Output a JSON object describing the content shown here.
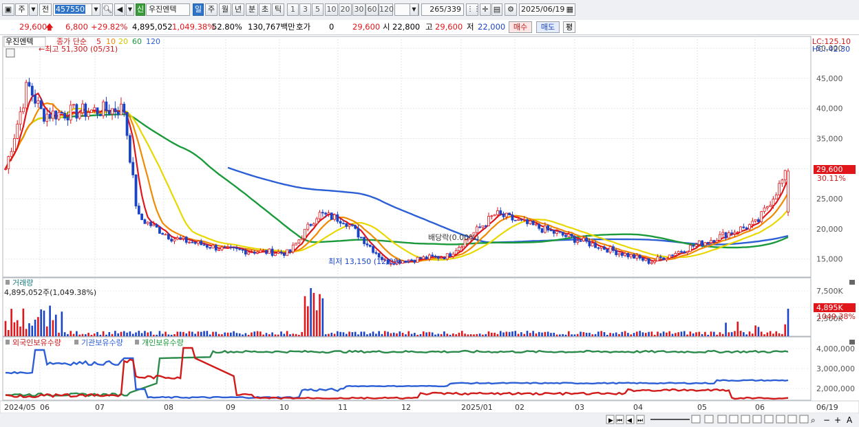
{
  "toolbar": {
    "market": "주",
    "mode": "전",
    "code": "457550",
    "badge": "신",
    "name": "우진엔텍",
    "periods": [
      "일",
      "주",
      "월",
      "년",
      "분",
      "초",
      "틱"
    ],
    "active_period": "일",
    "intervals": [
      "1",
      "3",
      "5",
      "10",
      "20",
      "30",
      "60",
      "120"
    ],
    "count": "265",
    "count_total": "/339",
    "date": "2025/06/19"
  },
  "quote": {
    "price": "29,600",
    "change": "6,800",
    "change_pct": "+29.82%",
    "volume": "4,895,052",
    "volume_pct": "1,049.38%",
    "turnover_pct": "52.80%",
    "amount": "130,767백만",
    "hoga_label": "호가",
    "hoga_value": "0",
    "hoga_price": "29,600",
    "open_label": "시",
    "open": "22,800",
    "high_label": "고",
    "high": "29,600",
    "low_label": "저",
    "low": "22,000",
    "buy_label": "매수",
    "sell_label": "매도",
    "flat_label": "평"
  },
  "price_panel": {
    "name_tag": "우진엔텍",
    "legend_prefix": "종가 단순",
    "ma_labels": [
      "5",
      "10",
      "20",
      "60",
      "120"
    ],
    "ma_colors": [
      "#e0161b",
      "#f08a00",
      "#e8d800",
      "#1a9a3a",
      "#2c5fd6"
    ],
    "lc_label": "LC:125.10",
    "hc_label": "HC:-42.30",
    "high_note": "최고 51,300 (05/31)",
    "low_note": "최저 13,150 (12/09)",
    "dividend_note": "배당락(0.00%)",
    "last_price_tag": "29,600",
    "last_pct_tag": "30.11%",
    "y_ticks": [
      "50,000",
      "45,000",
      "40,000",
      "35,000",
      "30,000",
      "25,000",
      "20,000",
      "15,000"
    ]
  },
  "volume_panel": {
    "title": "거래량",
    "value_label": "4,895,052주(1,049.38%)",
    "y_ticks": [
      "7,500K",
      "5,000K",
      "2,500K"
    ],
    "last_tag": "4,895K",
    "last_pct_tag": "1049.38%"
  },
  "holding_panel": {
    "legends": [
      "외국인보유수량",
      "기관보유수량",
      "개인보유수량"
    ],
    "y_ticks": [
      "4,000,000",
      "3,000,000",
      "2,000,000"
    ]
  },
  "x_axis": {
    "labels": [
      "2024/05",
      "06",
      "07",
      "08",
      "09",
      "10",
      "11",
      "12",
      "2025/01",
      "02",
      "03",
      "04",
      "05",
      "06"
    ],
    "right_label": "06/19"
  },
  "chart_data": {
    "type": "candlestick",
    "title": "우진엔텍",
    "x_range": [
      "2024/05",
      "2025/06/19"
    ],
    "ylim": [
      12000,
      51500
    ],
    "price_path": [
      {
        "m": "2024/05",
        "close": 30000
      },
      {
        "m": "2024/05 end",
        "close": 44000
      },
      {
        "m": "06",
        "close": 39000
      },
      {
        "m": "07 mid",
        "close": 40000
      },
      {
        "m": "07 end",
        "close": 22000
      },
      {
        "m": "08",
        "close": 18500
      },
      {
        "m": "09",
        "close": 16500
      },
      {
        "m": "10",
        "close": 16000
      },
      {
        "m": "10 end",
        "close": 22500
      },
      {
        "m": "11",
        "close": 21500
      },
      {
        "m": "12",
        "close": 14500
      },
      {
        "m": "2025/01",
        "close": 15500
      },
      {
        "m": "01 end",
        "close": 22500
      },
      {
        "m": "02",
        "close": 21000
      },
      {
        "m": "03",
        "close": 18500
      },
      {
        "m": "04",
        "close": 14500
      },
      {
        "m": "05",
        "close": 17500
      },
      {
        "m": "06",
        "close": 21000
      },
      {
        "m": "06/19",
        "close": 29600
      }
    ]
  }
}
